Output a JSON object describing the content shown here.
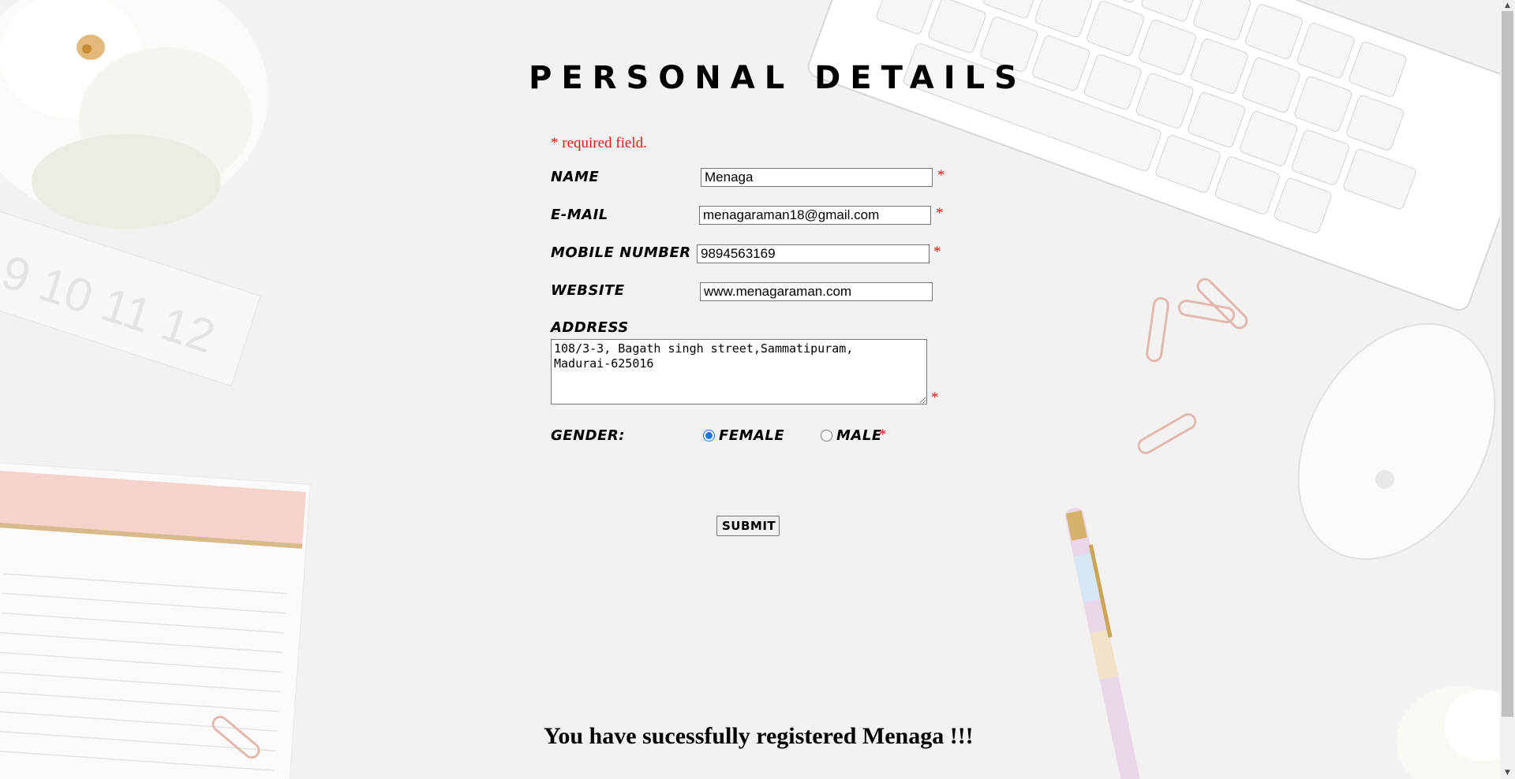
{
  "page": {
    "title": "PERSONAL DETAILS",
    "required_note": "* required field.",
    "required_marker": "*"
  },
  "form": {
    "name": {
      "label": "NAME",
      "value": "Menaga"
    },
    "email": {
      "label": "E-MAIL",
      "value": "menagaraman18@gmail.com"
    },
    "mobile": {
      "label": "MOBILE NUMBER",
      "value": "9894563169"
    },
    "website": {
      "label": "WEBSITE",
      "value": "www.menagaraman.com"
    },
    "address": {
      "label": "ADDRESS",
      "value": "108/3-3, Bagath singh street,Sammatipuram,\nMadurai-625016"
    },
    "gender": {
      "label": "GENDER",
      "separator": ":",
      "options": [
        {
          "label": "FEMALE",
          "checked": true
        },
        {
          "label": "MALE",
          "checked": false
        }
      ]
    },
    "submit_label": "SUBMIT"
  },
  "result": {
    "message": "You have sucessfully registered Menaga !!!"
  },
  "colors": {
    "required": "#e01818",
    "background": "#f3f2f1",
    "radio_accent": "#1a73e8"
  }
}
